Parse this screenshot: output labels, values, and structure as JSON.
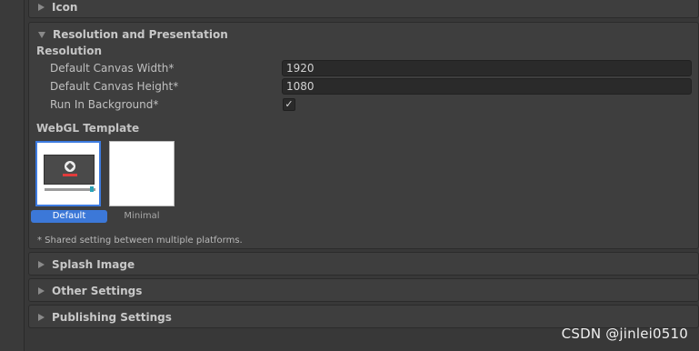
{
  "panels": {
    "icon": {
      "title": "Icon"
    },
    "resolution": {
      "title": "Resolution and Presentation"
    },
    "splash": {
      "title": "Splash Image"
    },
    "other": {
      "title": "Other Settings"
    },
    "publishing": {
      "title": "Publishing Settings"
    }
  },
  "resolution": {
    "section_label": "Resolution",
    "canvas_width_label": "Default Canvas Width*",
    "canvas_width_value": "1920",
    "canvas_height_label": "Default Canvas Height*",
    "canvas_height_value": "1080",
    "run_in_background_label": "Run In Background*",
    "run_in_background_checked": true,
    "check_glyph": "✓"
  },
  "webgl": {
    "section_label": "WebGL Template",
    "templates": [
      {
        "name": "Default",
        "selected": true
      },
      {
        "name": "Minimal",
        "selected": false
      }
    ]
  },
  "note": "* Shared setting between multiple platforms.",
  "watermark": "CSDN @jinlei0510",
  "colors": {
    "background": "#383838",
    "panel": "#3e3e3e",
    "selection": "#3c78d8",
    "input": "#2a2a2a"
  }
}
